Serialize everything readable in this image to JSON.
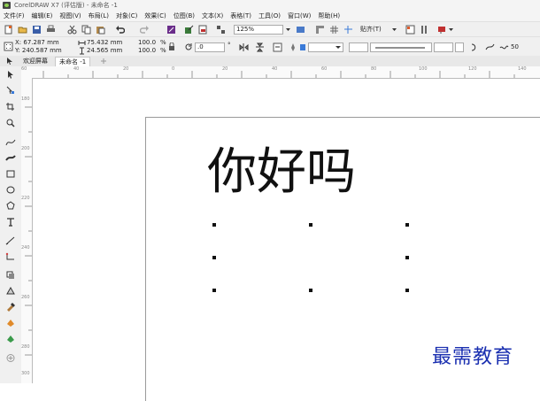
{
  "window": {
    "title": "CorelDRAW X7 (评估版) - 未命名 -1"
  },
  "menu": [
    "文件(F)",
    "编辑(E)",
    "视图(V)",
    "布局(L)",
    "对象(C)",
    "效果(C)",
    "位图(B)",
    "文本(X)",
    "表格(T)",
    "工具(O)",
    "窗口(W)",
    "帮助(H)"
  ],
  "toolbar": {
    "zoom": "125%",
    "snap": "贴齐(T)"
  },
  "property_bar": {
    "x": "X: 67.287 mm",
    "y": "Y: 240.587 mm",
    "width": "75.432 mm",
    "height": "24.565 mm",
    "scale_x": "100.0",
    "scale_y": "100.0",
    "pct": "%",
    "rotation": ".0",
    "degree": "°",
    "outline_value": "50"
  },
  "tabs": [
    {
      "label": "欢迎屏幕"
    },
    {
      "label": "未命名 -1"
    }
  ],
  "ruler": {
    "h_ticks": [
      "60",
      "40",
      "20",
      "0",
      "20",
      "40",
      "60",
      "80",
      "100",
      "120",
      "140"
    ],
    "v_ticks": [
      "180",
      "200",
      "220",
      "240",
      "260",
      "280",
      "300"
    ]
  },
  "artwork": {
    "text": "你好吗"
  },
  "watermark": "最需教育",
  "colors": {
    "accent": "#1a2fb0",
    "selection": "#111111"
  }
}
